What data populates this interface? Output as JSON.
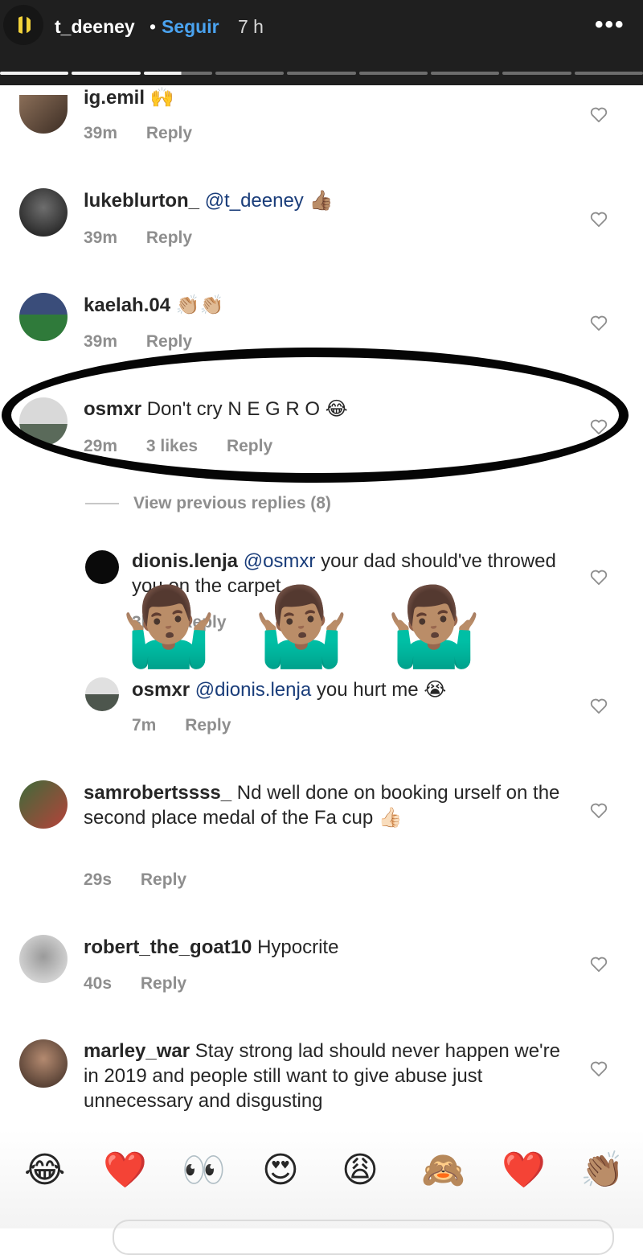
{
  "story": {
    "username": "t_deeney",
    "separator": "•",
    "follow_label": "Seguir",
    "time": "7 h",
    "more_label": "•••"
  },
  "comments": [
    {
      "username": "ig.emil",
      "text": "🙌",
      "time": "39m",
      "reply_label": "Reply"
    },
    {
      "username": "lukeblurton_",
      "mention": "@t_deeney",
      "text": " 👍🏽",
      "time": "39m",
      "reply_label": "Reply"
    },
    {
      "username": "kaelah.04",
      "text": "👏🏼👏🏼",
      "time": "39m",
      "reply_label": "Reply"
    },
    {
      "username": "osmxr",
      "text": "Don't cry N E G R O 😂",
      "time": "29m",
      "likes": "3 likes",
      "reply_label": "Reply"
    },
    {
      "username": "samrobertssss_",
      "text": "Nd well done on booking urself on the second place medal of the Fa cup 👍🏻",
      "time": "29s",
      "reply_label": "Reply"
    },
    {
      "username": "robert_the_goat10",
      "text": "Hypocrite",
      "time": "40s",
      "reply_label": "Reply"
    },
    {
      "username": "marley_war",
      "text": "Stay strong lad should never happen we're in 2019 and people still want to give abuse just unnecessary and disgusting"
    }
  ],
  "replies": {
    "view_previous": "View previous replies (8)",
    "items": [
      {
        "username": "dionis.lenja",
        "mention": "@osmxr",
        "text": " your dad should've throwed you on the carpet",
        "time": "3h",
        "reply_label": "Reply"
      },
      {
        "username": "osmxr",
        "mention": "@dionis.lenja",
        "text": " you hurt me 😭",
        "time": "7m",
        "reply_label": "Reply"
      }
    ]
  },
  "stickers": {
    "shrug": "🤷🏽‍♂️"
  },
  "reactions": [
    "😂",
    "❤️",
    "👀",
    "😍",
    "😩",
    "🙈",
    "❤️",
    "👏🏽"
  ],
  "colors": {
    "link": "#4aa3f0",
    "mention": "#1a3d7a",
    "muted": "#8e8e8e",
    "header_bg": "#1f1f1f"
  }
}
